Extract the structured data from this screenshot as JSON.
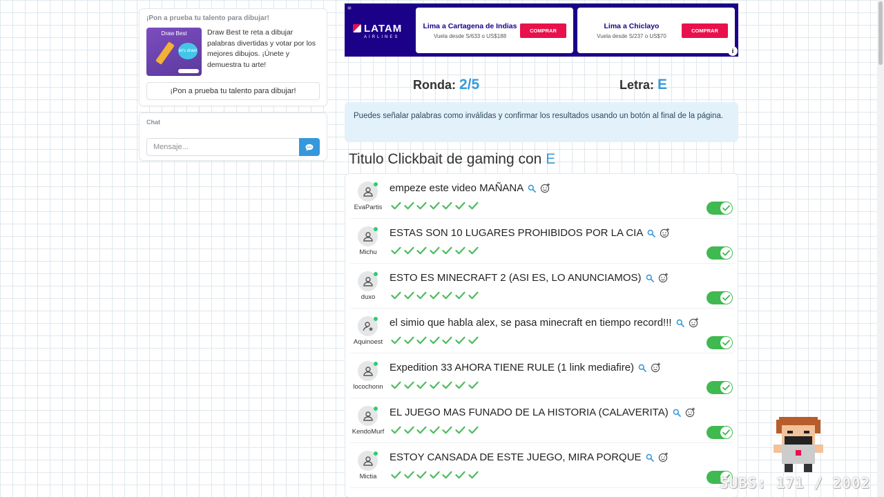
{
  "promo": {
    "heading": "¡Pon a prueba tu talento para dibujar!",
    "image_title": "Draw Best",
    "image_bubble": "let's draw!",
    "description": "Draw Best te reta a dibujar palabras divertidas y votar por los mejores dibujos. ¡Únete y demuestra tu arte!",
    "button_label": "¡Pon a prueba tu talento para dibujar!"
  },
  "chat": {
    "heading": "Chat",
    "placeholder": "Mensaje...",
    "send_icon": "chat-bubble-icon"
  },
  "ad": {
    "brand": "LATAM",
    "brand_sub": "AIRLINES",
    "offers": [
      {
        "route": "Lima a Cartagena de Indias",
        "price": "Vuela desde S/633 o US$188",
        "button": "COMPRAR"
      },
      {
        "route": "Lima a Chiclayo",
        "price": "Vuela desde S/237 o US$70",
        "button": "COMPRAR"
      }
    ],
    "info_badge": "i",
    "menu_icon": "="
  },
  "game": {
    "round_label": "Ronda:",
    "round_value": "2/5",
    "letter_label": "Letra:",
    "letter_value": "E",
    "notice": "Puedes señalar palabras como inválidas y confirmar los resultados usando un botón al final de la página.",
    "category_text": "Titulo Clickbait de gaming con",
    "category_letter": "E"
  },
  "answers": [
    {
      "user": "EvaPartis",
      "text": "empeze este video MAÑANA",
      "votes": 7,
      "valid": true,
      "avatar": "user-icon"
    },
    {
      "user": "Michu",
      "text": "ESTAS SON 10 LUGARES PROHIBIDOS POR LA CIA",
      "votes": 7,
      "valid": true,
      "avatar": "user-icon"
    },
    {
      "user": "duxo",
      "text": "ESTO ES MINECRAFT 2 (ASI ES, LO ANUNCIAMOS)",
      "votes": 7,
      "valid": true,
      "avatar": "user-icon"
    },
    {
      "user": "Aquinoest",
      "text": "el simio que habla alex, se pasa minecraft en tiempo record!!!",
      "votes": 7,
      "valid": true,
      "avatar": "user-star-icon"
    },
    {
      "user": "locochonn",
      "text": "Expedition 33 AHORA TIENE RULE (1 link mediafire)",
      "votes": 7,
      "valid": true,
      "avatar": "user-icon"
    },
    {
      "user": "KendoMurf",
      "text": "EL JUEGO MAS FUNADO DE LA HISTORIA (CALAVERITA)",
      "votes": 7,
      "valid": true,
      "avatar": "user-icon"
    },
    {
      "user": "Mictia",
      "text": "ESTOY CANSADA DE ESTE JUEGO, MIRA PORQUE",
      "votes": 7,
      "valid": true,
      "avatar": "user-icon"
    }
  ],
  "overlay": {
    "subs_text": "SUBS: 171 / 2002"
  },
  "colors": {
    "accent": "#3a9ad9",
    "valid_green": "#3fb950",
    "check_green": "#4cbb5c",
    "ad_background": "#1b0088",
    "ad_button": "#e8114b"
  }
}
